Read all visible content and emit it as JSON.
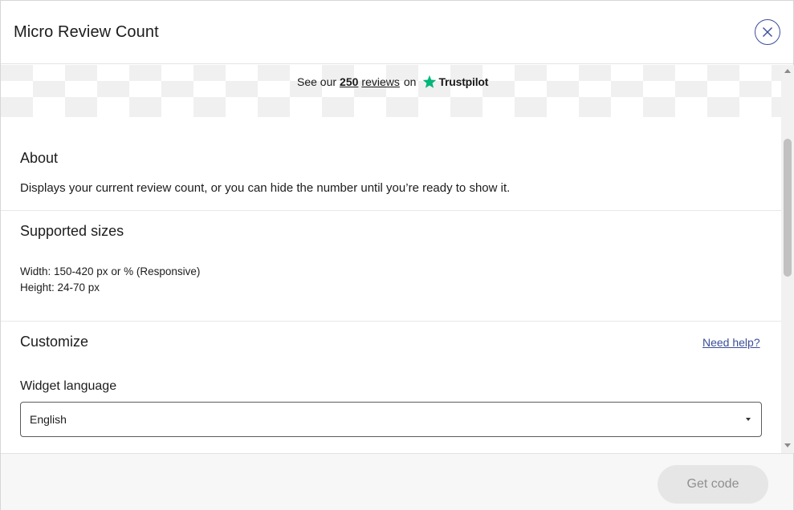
{
  "header": {
    "title": "Micro Review Count",
    "close_icon": "close-icon"
  },
  "preview": {
    "prefix": "See our",
    "count": "250",
    "reviews_label": "reviews",
    "on_label": "on",
    "brand": "Trustpilot",
    "brand_star_color": "#00b67a"
  },
  "about": {
    "heading": "About",
    "description": "Displays your current review count, or you can hide the number until you’re ready to show it."
  },
  "sizes": {
    "heading": "Supported sizes",
    "width": "Width: 150-420 px or % (Responsive)",
    "height": "Height: 24-70 px"
  },
  "customize": {
    "heading": "Customize",
    "help_link": "Need help?",
    "language_label": "Widget language",
    "language_value": "English"
  },
  "footer": {
    "get_code_label": "Get code"
  },
  "colors": {
    "accent": "#3b4e98",
    "disabled_button_bg": "#e6e6e6",
    "disabled_button_text": "#8f8f8f"
  }
}
